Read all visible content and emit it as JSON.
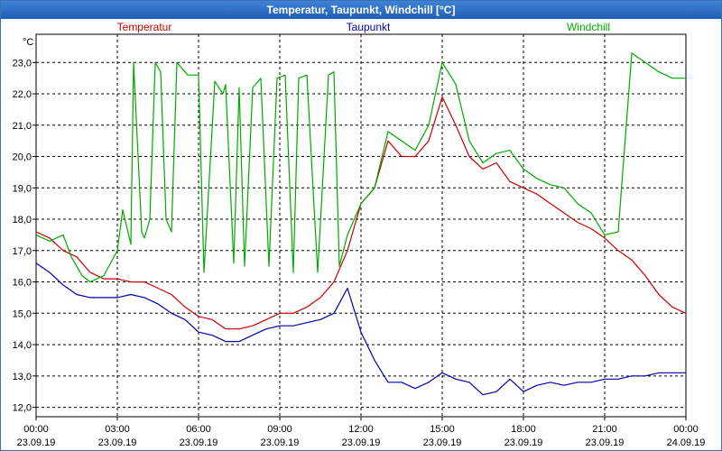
{
  "window": {
    "title": "Temperatur, Taupunkt, Windchill [°C]"
  },
  "chart_data": {
    "type": "line",
    "title": "Temperatur, Taupunkt, Windchill [°C]",
    "ylabel": "°C",
    "xlabel": "",
    "ylim": [
      11.7,
      23.9
    ],
    "xlim": [
      0,
      24
    ],
    "grid": true,
    "legend_placement": "top",
    "y_ticks": [
      "12,0",
      "13,0",
      "14,0",
      "15,0",
      "16,0",
      "17,0",
      "18,0",
      "19,0",
      "20,0",
      "21,0",
      "22,0",
      "23,0"
    ],
    "x_ticks": [
      {
        "time": "00:00",
        "date": "23.09.19"
      },
      {
        "time": "03:00",
        "date": "23.09.19"
      },
      {
        "time": "06:00",
        "date": "23.09.19"
      },
      {
        "time": "09:00",
        "date": "23.09.19"
      },
      {
        "time": "12:00",
        "date": "23.09.19"
      },
      {
        "time": "15:00",
        "date": "23.09.19"
      },
      {
        "time": "18:00",
        "date": "23.09.19"
      },
      {
        "time": "21:00",
        "date": "23.09.19"
      },
      {
        "time": "00:00",
        "date": "24.09.19"
      }
    ],
    "series": [
      {
        "name": "Temperatur",
        "color": "#cc0000",
        "points": [
          [
            0,
            17.6
          ],
          [
            0.5,
            17.4
          ],
          [
            1,
            17.0
          ],
          [
            1.5,
            16.8
          ],
          [
            2,
            16.3
          ],
          [
            2.5,
            16.1
          ],
          [
            3,
            16.1
          ],
          [
            3.5,
            16.0
          ],
          [
            4,
            16.0
          ],
          [
            4.5,
            15.8
          ],
          [
            5,
            15.6
          ],
          [
            5.5,
            15.2
          ],
          [
            6,
            14.9
          ],
          [
            6.5,
            14.8
          ],
          [
            7,
            14.5
          ],
          [
            7.5,
            14.5
          ],
          [
            8,
            14.6
          ],
          [
            8.5,
            14.8
          ],
          [
            9,
            15.0
          ],
          [
            9.5,
            15.0
          ],
          [
            10,
            15.2
          ],
          [
            10.5,
            15.5
          ],
          [
            11,
            16.0
          ],
          [
            11.5,
            17.0
          ],
          [
            12,
            18.5
          ],
          [
            12.5,
            19.0
          ],
          [
            13,
            20.5
          ],
          [
            13.5,
            20.0
          ],
          [
            14,
            20.0
          ],
          [
            14.5,
            20.5
          ],
          [
            15,
            21.9
          ],
          [
            15.5,
            21.0
          ],
          [
            16,
            20.0
          ],
          [
            16.5,
            19.6
          ],
          [
            17,
            19.8
          ],
          [
            17.5,
            19.2
          ],
          [
            18,
            19.0
          ],
          [
            18.5,
            18.8
          ],
          [
            19,
            18.5
          ],
          [
            19.5,
            18.2
          ],
          [
            20,
            17.9
          ],
          [
            20.5,
            17.7
          ],
          [
            21,
            17.4
          ],
          [
            21.5,
            17.0
          ],
          [
            22,
            16.7
          ],
          [
            22.5,
            16.2
          ],
          [
            23,
            15.6
          ],
          [
            23.5,
            15.2
          ],
          [
            24,
            15.0
          ]
        ]
      },
      {
        "name": "Taupunkt",
        "color": "#0000aa",
        "points": [
          [
            0,
            16.6
          ],
          [
            0.5,
            16.3
          ],
          [
            1,
            15.9
          ],
          [
            1.5,
            15.6
          ],
          [
            2,
            15.5
          ],
          [
            2.5,
            15.5
          ],
          [
            3,
            15.5
          ],
          [
            3.5,
            15.6
          ],
          [
            4,
            15.5
          ],
          [
            4.5,
            15.3
          ],
          [
            5,
            15.0
          ],
          [
            5.5,
            14.8
          ],
          [
            6,
            14.4
          ],
          [
            6.5,
            14.3
          ],
          [
            7,
            14.1
          ],
          [
            7.5,
            14.1
          ],
          [
            8,
            14.3
          ],
          [
            8.5,
            14.5
          ],
          [
            9,
            14.6
          ],
          [
            9.5,
            14.6
          ],
          [
            10,
            14.7
          ],
          [
            10.5,
            14.8
          ],
          [
            11,
            15.0
          ],
          [
            11.5,
            15.8
          ],
          [
            12,
            14.4
          ],
          [
            12.5,
            13.5
          ],
          [
            13,
            12.8
          ],
          [
            13.5,
            12.8
          ],
          [
            14,
            12.6
          ],
          [
            14.5,
            12.8
          ],
          [
            15,
            13.1
          ],
          [
            15.5,
            12.9
          ],
          [
            16,
            12.8
          ],
          [
            16.5,
            12.4
          ],
          [
            17,
            12.5
          ],
          [
            17.5,
            12.9
          ],
          [
            18,
            12.5
          ],
          [
            18.5,
            12.7
          ],
          [
            19,
            12.8
          ],
          [
            19.5,
            12.7
          ],
          [
            20,
            12.8
          ],
          [
            20.5,
            12.8
          ],
          [
            21,
            12.9
          ],
          [
            21.5,
            12.9
          ],
          [
            22,
            13.0
          ],
          [
            22.5,
            13.0
          ],
          [
            23,
            13.1
          ],
          [
            23.5,
            13.1
          ],
          [
            24,
            13.1
          ]
        ]
      },
      {
        "name": "Windchill",
        "color": "#00aa00",
        "points": [
          [
            0,
            17.5
          ],
          [
            0.5,
            17.3
          ],
          [
            1,
            17.5
          ],
          [
            1.3,
            16.8
          ],
          [
            1.7,
            16.2
          ],
          [
            2,
            16.0
          ],
          [
            2.5,
            16.2
          ],
          [
            3,
            17.0
          ],
          [
            3.2,
            18.3
          ],
          [
            3.5,
            17.2
          ],
          [
            3.6,
            23.0
          ],
          [
            3.9,
            17.6
          ],
          [
            4,
            17.4
          ],
          [
            4.2,
            18.0
          ],
          [
            4.4,
            23.0
          ],
          [
            4.6,
            22.7
          ],
          [
            4.8,
            18.0
          ],
          [
            5,
            17.6
          ],
          [
            5.2,
            23.0
          ],
          [
            5.6,
            22.6
          ],
          [
            6,
            22.6
          ],
          [
            6.2,
            16.3
          ],
          [
            6.6,
            22.4
          ],
          [
            6.9,
            22.0
          ],
          [
            7,
            22.3
          ],
          [
            7.3,
            16.6
          ],
          [
            7.5,
            22.2
          ],
          [
            7.7,
            16.5
          ],
          [
            8,
            22.2
          ],
          [
            8.3,
            22.5
          ],
          [
            8.6,
            16.5
          ],
          [
            8.9,
            22.5
          ],
          [
            9.2,
            22.6
          ],
          [
            9.5,
            16.3
          ],
          [
            9.7,
            22.5
          ],
          [
            10,
            22.6
          ],
          [
            10.4,
            16.3
          ],
          [
            10.8,
            22.6
          ],
          [
            11,
            22.7
          ],
          [
            11.2,
            16.5
          ],
          [
            11.5,
            17.5
          ],
          [
            12,
            18.5
          ],
          [
            12.5,
            19.0
          ],
          [
            13,
            20.8
          ],
          [
            13.5,
            20.5
          ],
          [
            14,
            20.2
          ],
          [
            14.5,
            21.0
          ],
          [
            15,
            23.0
          ],
          [
            15.5,
            22.3
          ],
          [
            16,
            20.5
          ],
          [
            16.5,
            19.8
          ],
          [
            17,
            20.1
          ],
          [
            17.5,
            20.2
          ],
          [
            18,
            19.6
          ],
          [
            18.5,
            19.3
          ],
          [
            19,
            19.1
          ],
          [
            19.5,
            19.0
          ],
          [
            20,
            18.5
          ],
          [
            20.5,
            18.2
          ],
          [
            21,
            17.5
          ],
          [
            21.5,
            17.6
          ],
          [
            22,
            23.3
          ],
          [
            22.5,
            23.0
          ],
          [
            23,
            22.7
          ],
          [
            23.5,
            22.5
          ],
          [
            24,
            22.5
          ]
        ]
      }
    ]
  }
}
